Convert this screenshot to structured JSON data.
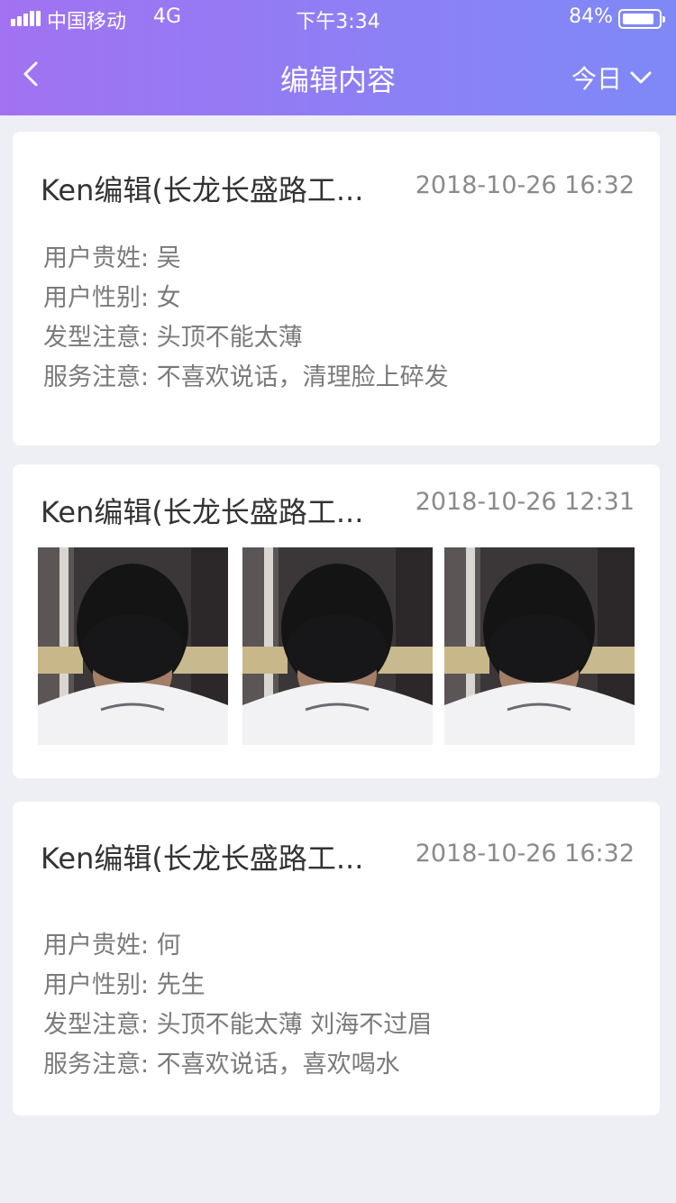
{
  "status_bar": {
    "carrier": "中国移动",
    "network": "4G",
    "time": "下午3:34",
    "battery": "84%"
  },
  "nav": {
    "title": "编辑内容",
    "date_filter": "今日"
  },
  "records": [
    {
      "title": "Ken编辑(长龙长盛路工...",
      "time": "2018-10-26 16:32",
      "fields": [
        "用户贵姓: 吴",
        "用户性别: 女",
        "发型注意: 头顶不能太薄",
        "服务注意: 不喜欢说话，清理脸上碎发"
      ]
    },
    {
      "title": "Ken编辑(长龙长盛路工...",
      "time": "2018-10-26 12:31",
      "photos": [
        "haircut-back-photo",
        "haircut-back-photo",
        "haircut-back-photo"
      ]
    },
    {
      "title": "Ken编辑(长龙长盛路工...",
      "time": "2018-10-26 16:32",
      "fields": [
        "用户贵姓: 何",
        "用户性别: 先生",
        "发型注意: 头顶不能太薄 刘海不过眉",
        "服务注意: 不喜欢说话，喜欢喝水"
      ]
    }
  ]
}
